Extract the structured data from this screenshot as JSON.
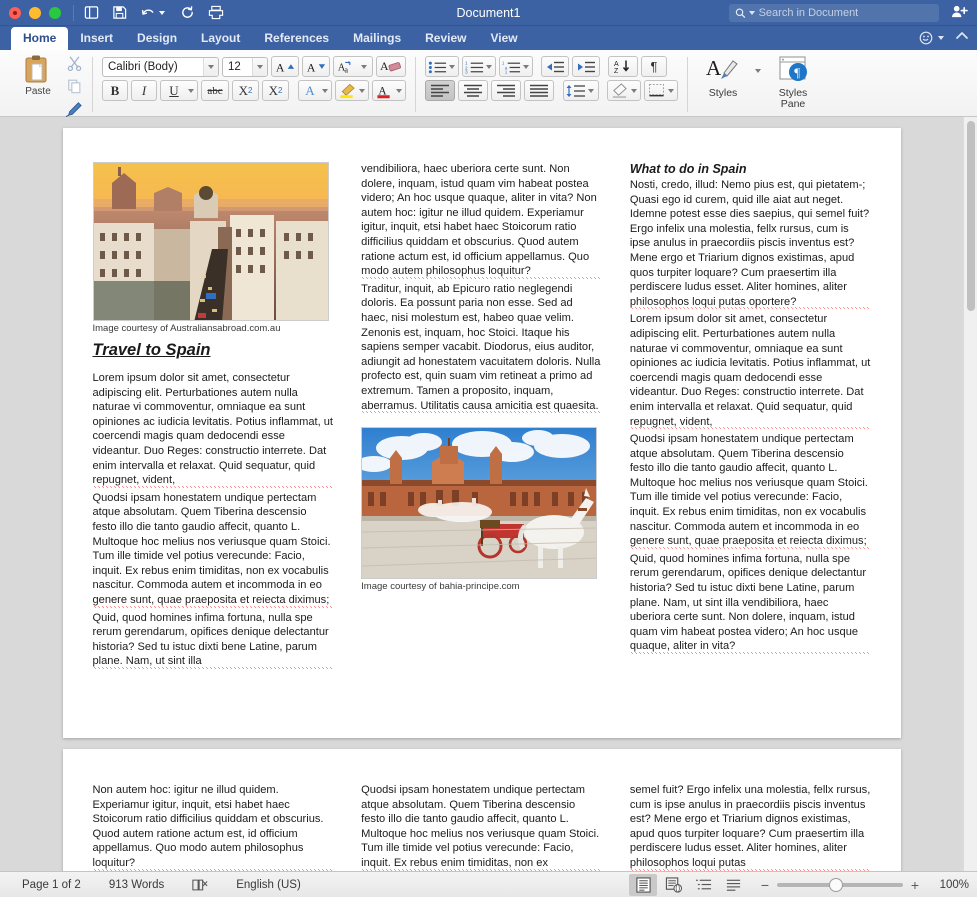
{
  "window": {
    "title": "Document1",
    "traffic_lights": [
      "close",
      "minimize",
      "maximize"
    ],
    "quick_icons": [
      "new-doc-icon",
      "save-icon",
      "undo-icon",
      "redo-icon",
      "print-icon"
    ],
    "accent_color": "#3c62a4"
  },
  "search": {
    "placeholder": "Search in Document",
    "value": ""
  },
  "tabs": [
    {
      "label": "Home",
      "active": true
    },
    {
      "label": "Insert",
      "active": false
    },
    {
      "label": "Design",
      "active": false
    },
    {
      "label": "Layout",
      "active": false
    },
    {
      "label": "References",
      "active": false
    },
    {
      "label": "Mailings",
      "active": false
    },
    {
      "label": "Review",
      "active": false
    },
    {
      "label": "View",
      "active": false
    }
  ],
  "ribbon": {
    "paste_label": "Paste",
    "clipboard_icons": [
      "cut-icon",
      "copy-icon",
      "format-painter-icon"
    ],
    "font_name": "Calibri (Body)",
    "font_size": "12",
    "font_buttons": [
      "grow-font-icon",
      "shrink-font-icon",
      "change-case-icon",
      "clear-formatting-icon"
    ],
    "style_buttons": [
      "bold-icon",
      "italic-icon",
      "underline-icon",
      "strikethrough-icon",
      "subscript-icon",
      "superscript-icon"
    ],
    "bold_label": "B",
    "italic_label": "I",
    "underline_label": "U",
    "strike_label": "abc",
    "sub_label": "X",
    "sub_sup": "2",
    "sup_label": "X",
    "sup_sup": "2",
    "color_buttons": [
      "text-effects-icon",
      "highlight-color-icon",
      "font-color-icon"
    ],
    "highlight_color": "#ffe800",
    "font_color": "#e02020",
    "paragraph_icons": [
      "bullets-icon",
      "numbering-icon",
      "multilevel-list-icon",
      "decrease-indent-icon",
      "increase-indent-icon",
      "sort-icon",
      "show-marks-icon"
    ],
    "sort_label_a": "A",
    "sort_label_z": "Z",
    "pilcrow": "¶",
    "align_icons": [
      "align-left-icon",
      "align-center-icon",
      "align-right-icon",
      "justify-icon"
    ],
    "align_active": "align-left-icon",
    "spacing_icons": [
      "line-spacing-icon",
      "shading-icon",
      "borders-icon"
    ],
    "styles_label": "Styles",
    "styles_pane_label": "Styles Pane"
  },
  "document": {
    "page1": {
      "image1": {
        "name": "madrid-cityscape-photo",
        "caption": "Image courtesy of Australiansabroad.com.au"
      },
      "image2": {
        "name": "seville-plaza-photo",
        "caption": "Image courtesy of bahia-principe.com"
      },
      "heading_left": "Travel to Spain",
      "heading_right": "What to do in Spain",
      "col1_paragraphs": [
        "Lorem ipsum dolor sit amet, consectetur adipiscing elit. Perturbationes autem nulla naturae vi commoventur, omniaque ea sunt opiniones ac iudicia levitatis. Potius inflammat, ut coercendi magis quam dedocendi esse videantur. Duo Reges: constructio interrete. Dat enim intervalla et relaxat. Quid sequatur, quid repugnet, vident,",
        "Quodsi ipsam honestatem undique pertectam atque absolutam. Quem Tiberina descensio festo illo die tanto gaudio affecit, quanto L. Multoque hoc melius nos veriusque quam Stoici. Tum ille timide vel potius verecunde: Facio, inquit. Ex rebus enim timiditas, non ex vocabulis nascitur. Commoda autem et incommoda in eo genere sunt, quae praeposita et reiecta diximus;",
        "Quid, quod homines infima fortuna, nulla spe rerum gerendarum, opifices denique delectantur historia? Sed tu istuc dixti bene Latine, parum plane. Nam, ut sint illa"
      ],
      "col2_paragraphs": [
        "vendibiliora, haec uberiora certe sunt. Non dolere, inquam, istud quam vim habeat postea videro; An hoc usque quaque, aliter in vita? Non autem hoc: igitur ne illud quidem. Experiamur igitur, inquit, etsi habet haec Stoicorum ratio difficilius quiddam et obscurius. Quod autem ratione actum est, id officium appellamus. Quo modo autem philosophus loquitur?",
        "Traditur, inquit, ab Epicuro ratio neglegendi doloris. Ea possunt paria non esse. Sed ad haec, nisi molestum est, habeo quae velim. Zenonis est, inquam, hoc Stoici. Itaque his sapiens semper vacabit. Diodorus, eius auditor, adiungit ad honestatem vacuitatem doloris. Nulla profecto est, quin suam vim retineat a primo ad extremum. Tamen a proposito, inquam, aberramus. Utilitatis causa amicitia est quaesita."
      ],
      "col3_paragraphs": [
        "Nosti, credo, illud: Nemo pius est, qui pietatem-; Quasi ego id curem, quid ille aiat aut neget. Idemne potest esse dies saepius, qui semel fuit? Ergo infelix una molestia, fellx rursus, cum is ipse anulus in praecordiis piscis inventus est? Mene ergo et Triarium dignos existimas, apud quos turpiter loquare? Cum praesertim illa perdiscere ludus esset. Aliter homines, aliter philosophos loqui putas oportere?",
        "Lorem ipsum dolor sit amet, consectetur adipiscing elit. Perturbationes autem nulla naturae vi commoventur, omniaque ea sunt opiniones ac iudicia levitatis. Potius inflammat, ut coercendi magis quam dedocendi esse videantur. Duo Reges: constructio interrete. Dat enim intervalla et relaxat. Quid sequatur, quid repugnet, vident,",
        "Quodsi ipsam honestatem undique pertectam atque absolutam. Quem Tiberina descensio festo illo die tanto gaudio affecit, quanto L. Multoque hoc melius nos veriusque quam Stoici. Tum ille timide vel potius verecunde: Facio, inquit. Ex rebus enim timiditas, non ex vocabulis nascitur. Commoda autem et incommoda in eo genere sunt, quae praeposita et reiecta diximus;",
        "Quid, quod homines infima fortuna, nulla spe rerum gerendarum, opifices denique delectantur historia? Sed tu istuc dixti bene Latine, parum plane. Nam, ut sint illa vendibiliora, haec uberiora certe sunt. Non dolere, inquam, istud quam vim habeat postea videro; An hoc usque quaque, aliter in vita?"
      ]
    },
    "page2": {
      "col1_paragraph": "Non autem hoc: igitur ne illud quidem. Experiamur igitur, inquit, etsi habet haec Stoicorum ratio difficilius quiddam et obscurius. Quod autem ratione actum est, id officium appellamus. Quo modo autem philosophus loquitur?",
      "col2_paragraph": "Quodsi ipsam honestatem undique pertectam atque absolutam. Quem Tiberina descensio festo illo die tanto gaudio affecit, quanto L. Multoque hoc melius nos veriusque quam Stoici. Tum ille timide vel potius verecunde: Facio, inquit. Ex rebus enim timiditas, non ex",
      "col3_paragraph": "semel fuit? Ergo infelix una molestia, fellx rursus, cum is ipse anulus in praecordiis piscis inventus est? Mene ergo et Triarium dignos existimas, apud quos turpiter loquare? Cum praesertim illa perdiscere ludus esset. Aliter homines, aliter philosophos loqui putas"
    }
  },
  "status": {
    "page_info": "Page 1 of 2",
    "word_count": "913 Words",
    "proofing_icon": "spelling-check-icon",
    "language": "English (US)",
    "view_buttons": [
      "print-layout-icon",
      "web-layout-icon",
      "outline-icon",
      "draft-icon"
    ],
    "view_active": "print-layout-icon",
    "zoom_out": "−",
    "zoom_in": "+",
    "zoom_value": "100%"
  }
}
